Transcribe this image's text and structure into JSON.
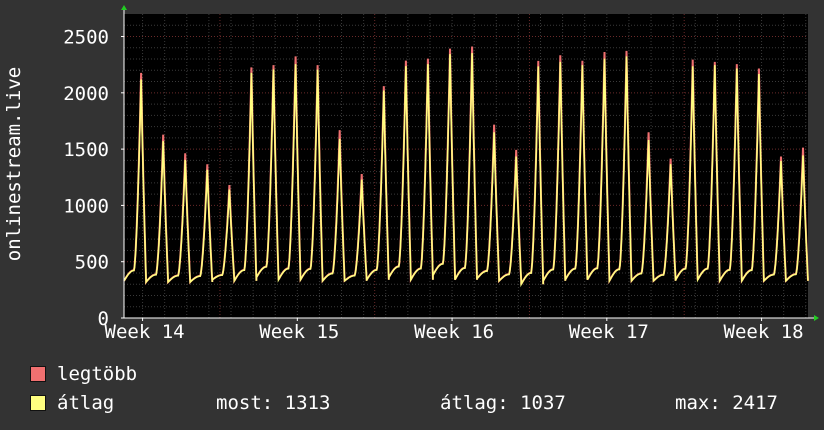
{
  "colors": {
    "background": "#333333",
    "plot_background": "#000000",
    "grid": "#6a2a2a",
    "axis": "#ffffff",
    "max_series": "#f07070",
    "avg_series": "#ffff80",
    "text": "#ffffff"
  },
  "legend": {
    "max_label": "legtöbb",
    "avg_label": "átlag",
    "current_label": "most:",
    "current_value": "1313",
    "avg_stat_label": "átlag:",
    "avg_stat_value": "1037",
    "max_stat_label": "max:",
    "max_stat_value": "2417"
  },
  "chart_data": {
    "type": "line",
    "ylabel": "onlinestream.live",
    "ylim": [
      0,
      2700
    ],
    "yticks": [
      0,
      500,
      1000,
      1500,
      2000,
      2500
    ],
    "xlim": [
      13.88,
      18.3
    ],
    "xticks": [
      {
        "label": "Week 14",
        "x": 14.0
      },
      {
        "label": "Week 15",
        "x": 15.0
      },
      {
        "label": "Week 16",
        "x": 16.0
      },
      {
        "label": "Week 17",
        "x": 17.0
      },
      {
        "label": "Week 18",
        "x": 18.0
      }
    ],
    "daily_peaks": {
      "max": [
        2220,
        1660,
        1490,
        1390,
        1200,
        2270,
        2290,
        2370,
        2290,
        1700,
        1300,
        2100,
        2330,
        2350,
        2440,
        2460,
        1750,
        1520,
        2330,
        2380,
        2330,
        2410,
        2420,
        1680,
        1440,
        2340,
        2320,
        2300,
        2260,
        1460,
        1540
      ],
      "avg": [
        2160,
        1600,
        1430,
        1340,
        1160,
        2220,
        2250,
        2300,
        2250,
        1620,
        1250,
        2060,
        2280,
        2300,
        2390,
        2400,
        1680,
        1460,
        2280,
        2320,
        2290,
        2350,
        2370,
        1610,
        1390,
        2280,
        2290,
        2260,
        2210,
        1420,
        1470
      ]
    },
    "daily_troughs": [
      330,
      320,
      320,
      320,
      340,
      330,
      360,
      340,
      340,
      330,
      330,
      340,
      360,
      340,
      380,
      340,
      350,
      330,
      300,
      330,
      340,
      340,
      330,
      330,
      330,
      340,
      340,
      330,
      330,
      330,
      330
    ],
    "series": [
      {
        "name": "legtöbb",
        "color": "#f07070"
      },
      {
        "name": "átlag",
        "color": "#ffff80"
      }
    ],
    "grid": true
  }
}
